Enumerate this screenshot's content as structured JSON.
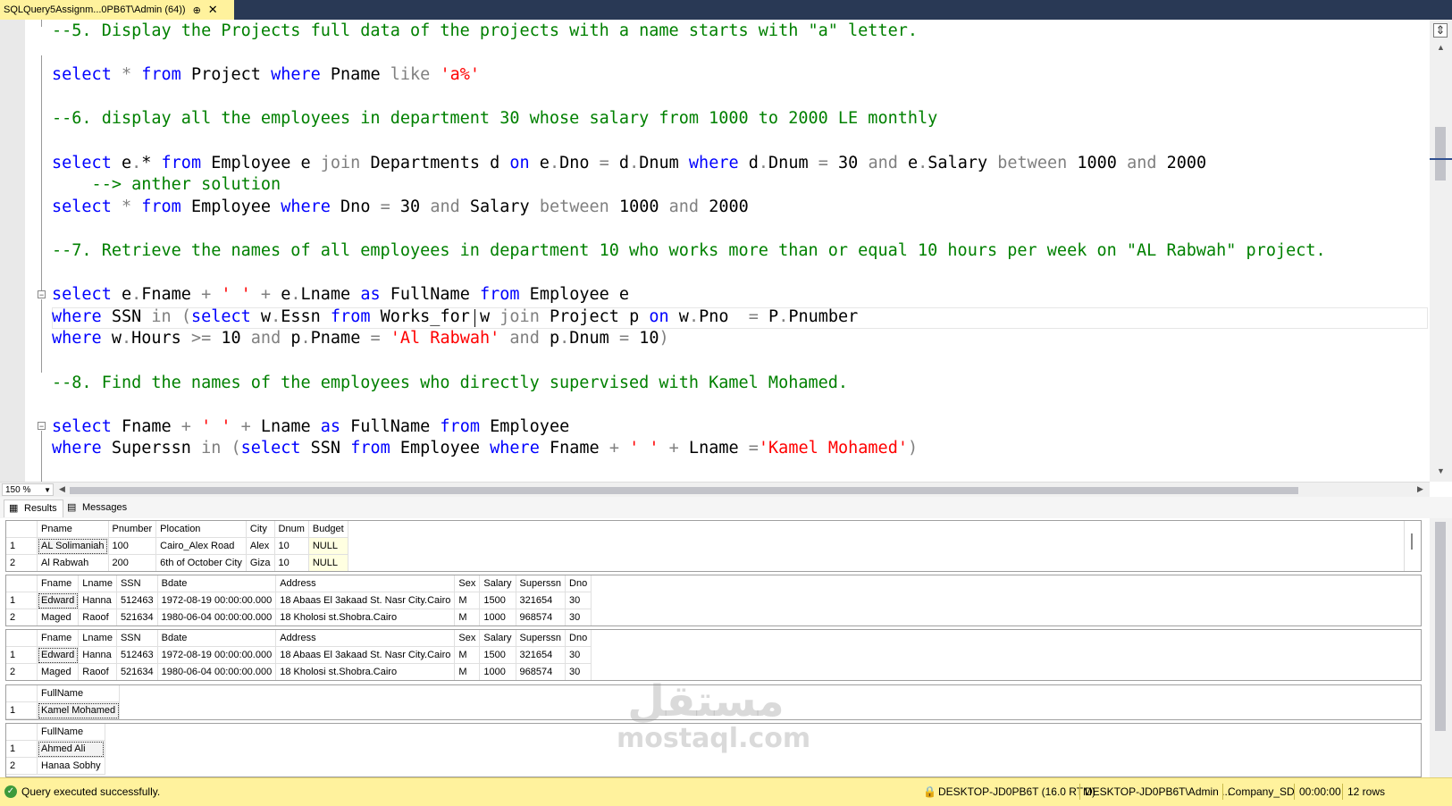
{
  "tab": {
    "title": "SQLQuery5Assignm...0PB6T\\Admin (64))",
    "pin": "⊕",
    "close": "✕"
  },
  "editor": {
    "lines": [
      [
        [
          "cmt",
          "--5. Display the Projects full data of the projects with a name starts with \"a\" letter."
        ]
      ],
      [],
      [
        [
          "kw",
          "select"
        ],
        [
          "gr",
          " * "
        ],
        [
          "kw",
          "from"
        ],
        [
          "tx",
          " Project "
        ],
        [
          "kw",
          "where"
        ],
        [
          "tx",
          " Pname "
        ],
        [
          "gr",
          "like "
        ],
        [
          "str",
          "'a%'"
        ]
      ],
      [],
      [
        [
          "cmt",
          "--6. display all the employees in department 30 whose salary from 1000 to 2000 LE monthly"
        ]
      ],
      [],
      [
        [
          "kw",
          "select"
        ],
        [
          "tx",
          " e"
        ],
        [
          "gr",
          "."
        ],
        [
          "tx",
          "*"
        ],
        [
          "tx",
          " "
        ],
        [
          "kw",
          "from"
        ],
        [
          "tx",
          " Employee e "
        ],
        [
          "gr",
          "join"
        ],
        [
          "tx",
          " Departments d "
        ],
        [
          "kw",
          "on"
        ],
        [
          "tx",
          " e"
        ],
        [
          "gr",
          "."
        ],
        [
          "tx",
          "Dno "
        ],
        [
          "gr",
          "="
        ],
        [
          "tx",
          " d"
        ],
        [
          "gr",
          "."
        ],
        [
          "tx",
          "Dnum "
        ],
        [
          "kw",
          "where"
        ],
        [
          "tx",
          " d"
        ],
        [
          "gr",
          "."
        ],
        [
          "tx",
          "Dnum "
        ],
        [
          "gr",
          "="
        ],
        [
          "tx",
          " 30 "
        ],
        [
          "gr",
          "and"
        ],
        [
          "tx",
          " e"
        ],
        [
          "gr",
          "."
        ],
        [
          "tx",
          "Salary "
        ],
        [
          "gr",
          "between"
        ],
        [
          "tx",
          " 1000 "
        ],
        [
          "gr",
          "and"
        ],
        [
          "tx",
          " 2000"
        ]
      ],
      [
        [
          "cmt",
          "    --> anther solution"
        ]
      ],
      [
        [
          "kw",
          "select"
        ],
        [
          "gr",
          " * "
        ],
        [
          "kw",
          "from"
        ],
        [
          "tx",
          " Employee "
        ],
        [
          "kw",
          "where"
        ],
        [
          "tx",
          " Dno "
        ],
        [
          "gr",
          "="
        ],
        [
          "tx",
          " 30 "
        ],
        [
          "gr",
          "and"
        ],
        [
          "tx",
          " Salary "
        ],
        [
          "gr",
          "between"
        ],
        [
          "tx",
          " 1000 "
        ],
        [
          "gr",
          "and"
        ],
        [
          "tx",
          " 2000"
        ]
      ],
      [],
      [
        [
          "cmt",
          "--7. Retrieve the names of all employees in department 10 who works more than or equal 10 hours per week on \"AL Rabwah\" project."
        ]
      ],
      [],
      [
        [
          "kw",
          "select"
        ],
        [
          "tx",
          " e"
        ],
        [
          "gr",
          "."
        ],
        [
          "tx",
          "Fname "
        ],
        [
          "gr",
          "+"
        ],
        [
          "tx",
          " "
        ],
        [
          "str",
          "' '"
        ],
        [
          "tx",
          " "
        ],
        [
          "gr",
          "+"
        ],
        [
          "tx",
          " e"
        ],
        [
          "gr",
          "."
        ],
        [
          "tx",
          "Lname "
        ],
        [
          "kw",
          "as"
        ],
        [
          "tx",
          " FullName "
        ],
        [
          "kw",
          "from"
        ],
        [
          "tx",
          " Employee e"
        ]
      ],
      [
        [
          "kw",
          "where"
        ],
        [
          "tx",
          " SSN "
        ],
        [
          "gr",
          "in"
        ],
        [
          "tx",
          " "
        ],
        [
          "gr",
          "("
        ],
        [
          "kw",
          "select"
        ],
        [
          "tx",
          " w"
        ],
        [
          "gr",
          "."
        ],
        [
          "tx",
          "Essn "
        ],
        [
          "kw",
          "from"
        ],
        [
          "tx",
          " Works_for w "
        ],
        [
          "gr",
          "join"
        ],
        [
          "tx",
          " Project p "
        ],
        [
          "kw",
          "on"
        ],
        [
          "tx",
          " w"
        ],
        [
          "gr",
          "."
        ],
        [
          "tx",
          "Pno  "
        ],
        [
          "gr",
          "="
        ],
        [
          "tx",
          " P"
        ],
        [
          "gr",
          "."
        ],
        [
          "tx",
          "Pnumber"
        ]
      ],
      [
        [
          "kw",
          "where"
        ],
        [
          "tx",
          " w"
        ],
        [
          "gr",
          "."
        ],
        [
          "tx",
          "Hours "
        ],
        [
          "gr",
          ">="
        ],
        [
          "tx",
          " 10 "
        ],
        [
          "gr",
          "and"
        ],
        [
          "tx",
          " p"
        ],
        [
          "gr",
          "."
        ],
        [
          "tx",
          "Pname "
        ],
        [
          "gr",
          "="
        ],
        [
          "tx",
          " "
        ],
        [
          "str",
          "'Al Rabwah'"
        ],
        [
          "tx",
          " "
        ],
        [
          "gr",
          "and"
        ],
        [
          "tx",
          " p"
        ],
        [
          "gr",
          "."
        ],
        [
          "tx",
          "Dnum "
        ],
        [
          "gr",
          "="
        ],
        [
          "tx",
          " 10"
        ],
        [
          "gr",
          ")"
        ]
      ],
      [],
      [
        [
          "cmt",
          "--8. Find the names of the employees who directly supervised with Kamel Mohamed."
        ]
      ],
      [],
      [
        [
          "kw",
          "select"
        ],
        [
          "tx",
          " Fname "
        ],
        [
          "gr",
          "+"
        ],
        [
          "tx",
          " "
        ],
        [
          "str",
          "' '"
        ],
        [
          "tx",
          " "
        ],
        [
          "gr",
          "+"
        ],
        [
          "tx",
          " Lname "
        ],
        [
          "kw",
          "as"
        ],
        [
          "tx",
          " FullName "
        ],
        [
          "kw",
          "from"
        ],
        [
          "tx",
          " Employee"
        ]
      ],
      [
        [
          "kw",
          "where"
        ],
        [
          "tx",
          " Superssn "
        ],
        [
          "gr",
          "in"
        ],
        [
          "tx",
          " "
        ],
        [
          "gr",
          "("
        ],
        [
          "kw",
          "select"
        ],
        [
          "tx",
          " SSN "
        ],
        [
          "kw",
          "from"
        ],
        [
          "tx",
          " Employee "
        ],
        [
          "kw",
          "where"
        ],
        [
          "tx",
          " Fname "
        ],
        [
          "gr",
          "+"
        ],
        [
          "tx",
          " "
        ],
        [
          "str",
          "' '"
        ],
        [
          "tx",
          " "
        ],
        [
          "gr",
          "+"
        ],
        [
          "tx",
          " Lname "
        ],
        [
          "gr",
          "="
        ],
        [
          "str",
          "'Kamel Mohamed'"
        ],
        [
          "gr",
          ")"
        ]
      ]
    ]
  },
  "zoom": {
    "value": "150 %"
  },
  "result_tabs": {
    "results": "Results",
    "messages": "Messages"
  },
  "grids": [
    {
      "columns": [
        "Pname",
        "Pnumber",
        "Plocation",
        "City",
        "Dnum",
        "Budget"
      ],
      "rows": [
        [
          "1",
          "AL Solimaniah",
          "100",
          "Cairo_Alex Road",
          "Alex",
          "10",
          "NULL"
        ],
        [
          "2",
          "Al Rabwah",
          "200",
          "6th of October City",
          "Giza",
          "10",
          "NULL"
        ]
      ]
    },
    {
      "columns": [
        "Fname",
        "Lname",
        "SSN",
        "Bdate",
        "Address",
        "Sex",
        "Salary",
        "Superssn",
        "Dno"
      ],
      "rows": [
        [
          "1",
          "Edward",
          "Hanna",
          "512463",
          "1972-08-19 00:00:00.000",
          "18 Abaas El 3akaad St. Nasr City.Cairo",
          "M",
          "1500",
          "321654",
          "30"
        ],
        [
          "2",
          "Maged",
          "Raoof",
          "521634",
          "1980-06-04 00:00:00.000",
          "18 Kholosi st.Shobra.Cairo",
          "M",
          "1000",
          "968574",
          "30"
        ]
      ]
    },
    {
      "columns": [
        "Fname",
        "Lname",
        "SSN",
        "Bdate",
        "Address",
        "Sex",
        "Salary",
        "Superssn",
        "Dno"
      ],
      "rows": [
        [
          "1",
          "Edward",
          "Hanna",
          "512463",
          "1972-08-19 00:00:00.000",
          "18 Abaas El 3akaad St. Nasr City.Cairo",
          "M",
          "1500",
          "321654",
          "30"
        ],
        [
          "2",
          "Maged",
          "Raoof",
          "521634",
          "1980-06-04 00:00:00.000",
          "18 Kholosi st.Shobra.Cairo",
          "M",
          "1000",
          "968574",
          "30"
        ]
      ]
    },
    {
      "columns": [
        "FullName"
      ],
      "rows": [
        [
          "1",
          "Kamel Mohamed"
        ]
      ]
    },
    {
      "columns": [
        "FullName"
      ],
      "rows": [
        [
          "1",
          "Ahmed Ali"
        ],
        [
          "2",
          "Hanaa Sobhy"
        ]
      ]
    }
  ],
  "watermark": {
    "arabic": "مستقل",
    "latin": "mostaql.com"
  },
  "status": {
    "message": "Query executed successfully.",
    "server": "DESKTOP-JD0PB6T (16.0 RTM)",
    "user": "DESKTOP-JD0PB6T\\Admin ...",
    "database": "Company_SD",
    "elapsed": "00:00:00",
    "rows": "12 rows"
  },
  "colors": {
    "tab_active": "#fff29d",
    "status_bar": "#fff29d",
    "keyword": "#0000ff",
    "comment": "#008000",
    "string": "#ff0000",
    "operator": "#808080"
  }
}
